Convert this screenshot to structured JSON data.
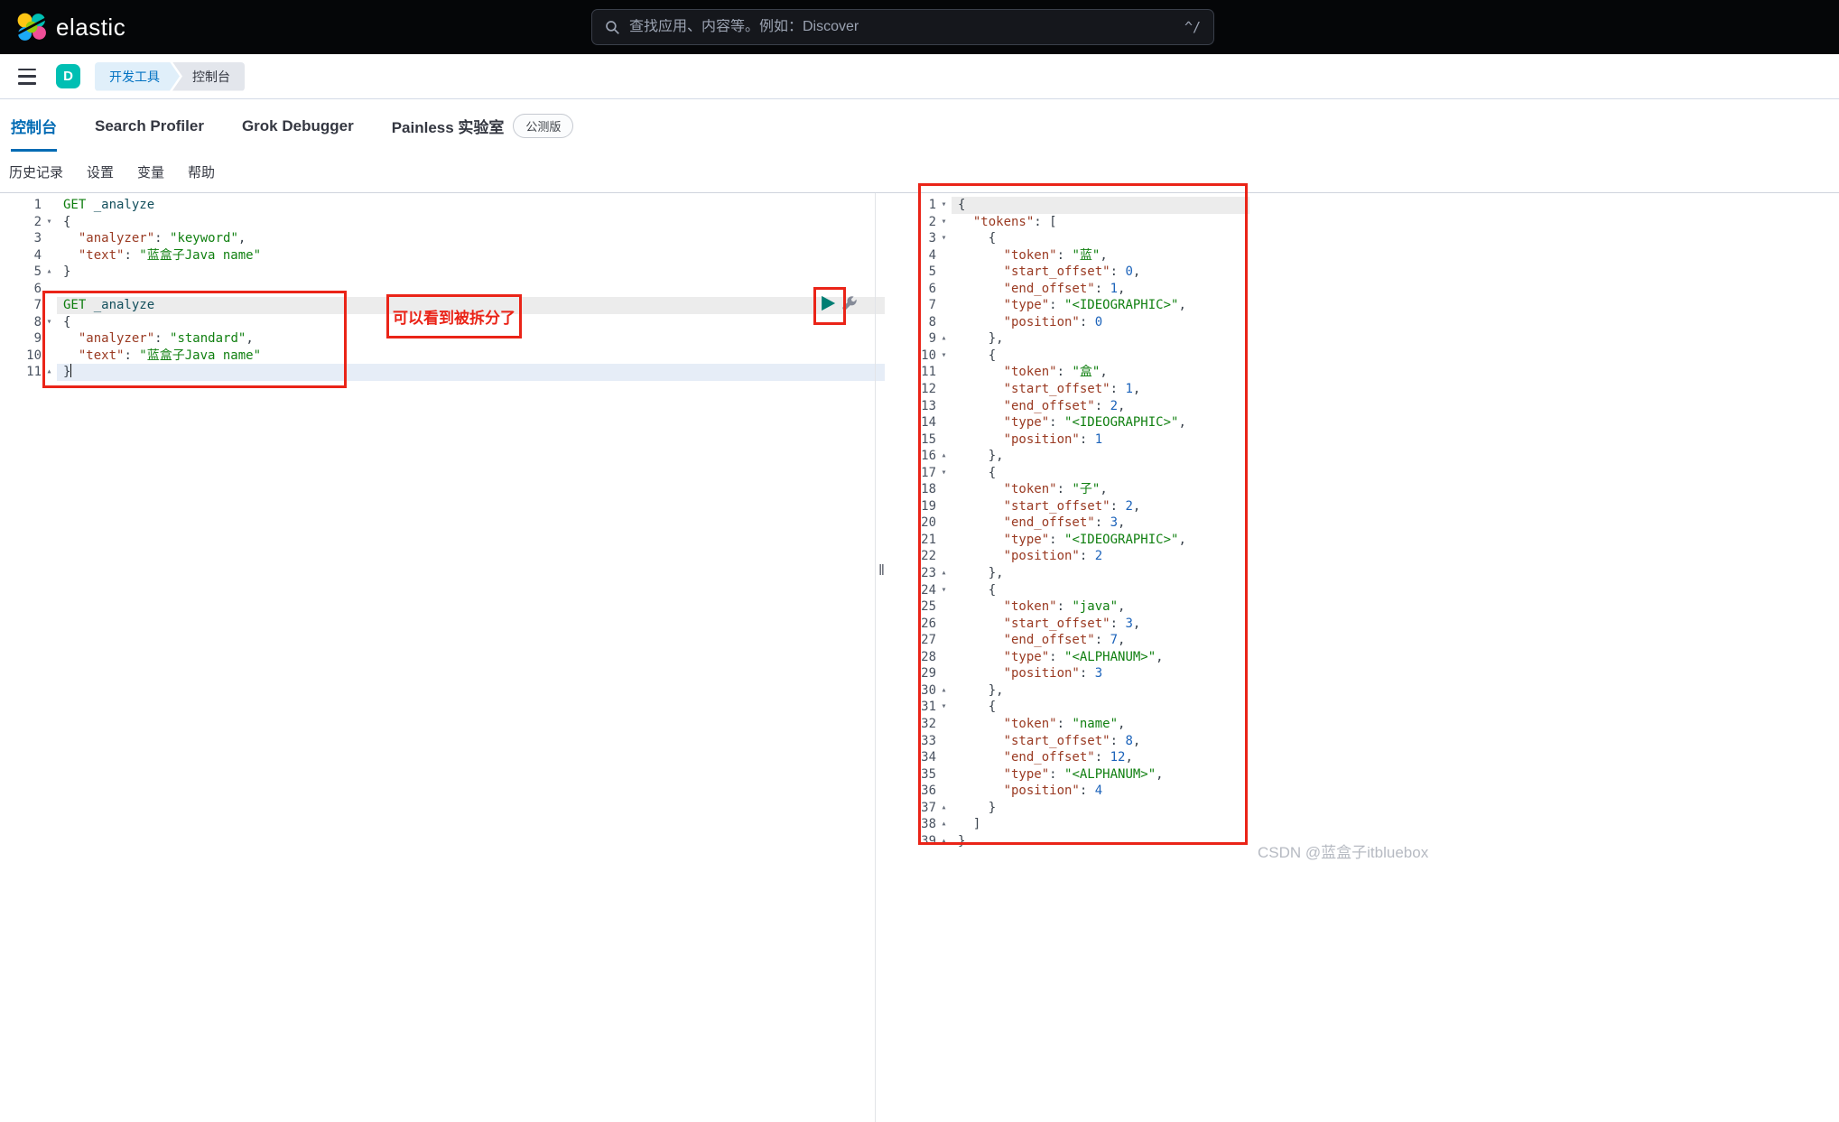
{
  "topbar": {
    "brand": "elastic",
    "search_placeholder": "查找应用、内容等。例如：Discover",
    "shortcut_hint": "^/"
  },
  "navbar": {
    "space_initial": "D",
    "breadcrumbs": [
      "开发工具",
      "控制台"
    ]
  },
  "tabs": {
    "items": [
      {
        "label": "控制台",
        "active": true
      },
      {
        "label": "Search Profiler",
        "active": false
      },
      {
        "label": "Grok Debugger",
        "active": false
      },
      {
        "label": "Painless 实验室",
        "active": false,
        "badge": "公测版"
      }
    ]
  },
  "menubar": {
    "items": [
      "历史记录",
      "设置",
      "变量",
      "帮助"
    ]
  },
  "icons": {
    "search": "magnifier",
    "menu": "hamburger",
    "send": "play-triangle",
    "settings": "wrench",
    "resizer": "‖",
    "fold_open": "▾",
    "fold_collapse": "▴"
  },
  "colors": {
    "accent": "#006bb4",
    "annotation_red": "#ea2418",
    "play_green": "#017d73",
    "space_avatar": "#00bfb3"
  },
  "annotations": {
    "callout_text": "可以看到被拆分了"
  },
  "watermark": "CSDN @蓝盒子itbluebox",
  "editor": {
    "lines": [
      {
        "n": "1",
        "seg": [
          {
            "t": "GET ",
            "c": "m"
          },
          {
            "t": "_analyze",
            "c": "u"
          }
        ]
      },
      {
        "n": "2",
        "f": "d",
        "seg": [
          {
            "t": "{",
            "c": "p"
          }
        ]
      },
      {
        "n": "3",
        "seg": [
          {
            "t": "  "
          },
          {
            "t": "\"analyzer\"",
            "c": "k"
          },
          {
            "t": ": ",
            "c": "p"
          },
          {
            "t": "\"keyword\"",
            "c": "s"
          },
          {
            "t": ",",
            "c": "p"
          }
        ]
      },
      {
        "n": "4",
        "seg": [
          {
            "t": "  "
          },
          {
            "t": "\"text\"",
            "c": "k"
          },
          {
            "t": ": ",
            "c": "p"
          },
          {
            "t": "\"蓝盒子Java name\"",
            "c": "s"
          }
        ]
      },
      {
        "n": "5",
        "f": "u",
        "seg": [
          {
            "t": "}",
            "c": "p"
          }
        ]
      },
      {
        "n": "6",
        "seg": []
      },
      {
        "n": "7",
        "hl": "gray",
        "seg": [
          {
            "t": "GET ",
            "c": "m"
          },
          {
            "t": "_analyze",
            "c": "u"
          }
        ]
      },
      {
        "n": "8",
        "f": "d",
        "seg": [
          {
            "t": "{",
            "c": "p"
          }
        ]
      },
      {
        "n": "9",
        "seg": [
          {
            "t": "  "
          },
          {
            "t": "\"analyzer\"",
            "c": "k"
          },
          {
            "t": ": ",
            "c": "p"
          },
          {
            "t": "\"standard\"",
            "c": "s"
          },
          {
            "t": ",",
            "c": "p"
          }
        ]
      },
      {
        "n": "10",
        "seg": [
          {
            "t": "  "
          },
          {
            "t": "\"text\"",
            "c": "k"
          },
          {
            "t": ": ",
            "c": "p"
          },
          {
            "t": "\"蓝盒子Java name\"",
            "c": "s"
          }
        ]
      },
      {
        "n": "11",
        "f": "u",
        "hl": "blue",
        "cursor": true,
        "seg": [
          {
            "t": "}",
            "c": "p"
          }
        ]
      }
    ]
  },
  "response": {
    "lines": [
      {
        "n": "1",
        "f": "d",
        "hl": "gray",
        "seg": [
          {
            "t": "{",
            "c": "p"
          }
        ]
      },
      {
        "n": "2",
        "f": "d",
        "seg": [
          {
            "t": "  "
          },
          {
            "t": "\"tokens\"",
            "c": "k"
          },
          {
            "t": ": ",
            "c": "p"
          },
          {
            "t": "[",
            "c": "p"
          }
        ]
      },
      {
        "n": "3",
        "f": "d",
        "seg": [
          {
            "t": "    "
          },
          {
            "t": "{",
            "c": "p"
          }
        ]
      },
      {
        "n": "4",
        "seg": [
          {
            "t": "      "
          },
          {
            "t": "\"token\"",
            "c": "k"
          },
          {
            "t": ": ",
            "c": "p"
          },
          {
            "t": "\"蓝\"",
            "c": "s"
          },
          {
            "t": ",",
            "c": "p"
          }
        ]
      },
      {
        "n": "5",
        "seg": [
          {
            "t": "      "
          },
          {
            "t": "\"start_offset\"",
            "c": "k"
          },
          {
            "t": ": ",
            "c": "p"
          },
          {
            "t": "0",
            "c": "n"
          },
          {
            "t": ",",
            "c": "p"
          }
        ]
      },
      {
        "n": "6",
        "seg": [
          {
            "t": "      "
          },
          {
            "t": "\"end_offset\"",
            "c": "k"
          },
          {
            "t": ": ",
            "c": "p"
          },
          {
            "t": "1",
            "c": "n"
          },
          {
            "t": ",",
            "c": "p"
          }
        ]
      },
      {
        "n": "7",
        "seg": [
          {
            "t": "      "
          },
          {
            "t": "\"type\"",
            "c": "k"
          },
          {
            "t": ": ",
            "c": "p"
          },
          {
            "t": "\"<IDEOGRAPHIC>\"",
            "c": "s"
          },
          {
            "t": ",",
            "c": "p"
          }
        ]
      },
      {
        "n": "8",
        "seg": [
          {
            "t": "      "
          },
          {
            "t": "\"position\"",
            "c": "k"
          },
          {
            "t": ": ",
            "c": "p"
          },
          {
            "t": "0",
            "c": "n"
          }
        ]
      },
      {
        "n": "9",
        "f": "u",
        "seg": [
          {
            "t": "    "
          },
          {
            "t": "},",
            "c": "p"
          }
        ]
      },
      {
        "n": "10",
        "f": "d",
        "seg": [
          {
            "t": "    "
          },
          {
            "t": "{",
            "c": "p"
          }
        ]
      },
      {
        "n": "11",
        "seg": [
          {
            "t": "      "
          },
          {
            "t": "\"token\"",
            "c": "k"
          },
          {
            "t": ": ",
            "c": "p"
          },
          {
            "t": "\"盒\"",
            "c": "s"
          },
          {
            "t": ",",
            "c": "p"
          }
        ]
      },
      {
        "n": "12",
        "seg": [
          {
            "t": "      "
          },
          {
            "t": "\"start_offset\"",
            "c": "k"
          },
          {
            "t": ": ",
            "c": "p"
          },
          {
            "t": "1",
            "c": "n"
          },
          {
            "t": ",",
            "c": "p"
          }
        ]
      },
      {
        "n": "13",
        "seg": [
          {
            "t": "      "
          },
          {
            "t": "\"end_offset\"",
            "c": "k"
          },
          {
            "t": ": ",
            "c": "p"
          },
          {
            "t": "2",
            "c": "n"
          },
          {
            "t": ",",
            "c": "p"
          }
        ]
      },
      {
        "n": "14",
        "seg": [
          {
            "t": "      "
          },
          {
            "t": "\"type\"",
            "c": "k"
          },
          {
            "t": ": ",
            "c": "p"
          },
          {
            "t": "\"<IDEOGRAPHIC>\"",
            "c": "s"
          },
          {
            "t": ",",
            "c": "p"
          }
        ]
      },
      {
        "n": "15",
        "seg": [
          {
            "t": "      "
          },
          {
            "t": "\"position\"",
            "c": "k"
          },
          {
            "t": ": ",
            "c": "p"
          },
          {
            "t": "1",
            "c": "n"
          }
        ]
      },
      {
        "n": "16",
        "f": "u",
        "seg": [
          {
            "t": "    "
          },
          {
            "t": "},",
            "c": "p"
          }
        ]
      },
      {
        "n": "17",
        "f": "d",
        "seg": [
          {
            "t": "    "
          },
          {
            "t": "{",
            "c": "p"
          }
        ]
      },
      {
        "n": "18",
        "seg": [
          {
            "t": "      "
          },
          {
            "t": "\"token\"",
            "c": "k"
          },
          {
            "t": ": ",
            "c": "p"
          },
          {
            "t": "\"子\"",
            "c": "s"
          },
          {
            "t": ",",
            "c": "p"
          }
        ]
      },
      {
        "n": "19",
        "seg": [
          {
            "t": "      "
          },
          {
            "t": "\"start_offset\"",
            "c": "k"
          },
          {
            "t": ": ",
            "c": "p"
          },
          {
            "t": "2",
            "c": "n"
          },
          {
            "t": ",",
            "c": "p"
          }
        ]
      },
      {
        "n": "20",
        "seg": [
          {
            "t": "      "
          },
          {
            "t": "\"end_offset\"",
            "c": "k"
          },
          {
            "t": ": ",
            "c": "p"
          },
          {
            "t": "3",
            "c": "n"
          },
          {
            "t": ",",
            "c": "p"
          }
        ]
      },
      {
        "n": "21",
        "seg": [
          {
            "t": "      "
          },
          {
            "t": "\"type\"",
            "c": "k"
          },
          {
            "t": ": ",
            "c": "p"
          },
          {
            "t": "\"<IDEOGRAPHIC>\"",
            "c": "s"
          },
          {
            "t": ",",
            "c": "p"
          }
        ]
      },
      {
        "n": "22",
        "seg": [
          {
            "t": "      "
          },
          {
            "t": "\"position\"",
            "c": "k"
          },
          {
            "t": ": ",
            "c": "p"
          },
          {
            "t": "2",
            "c": "n"
          }
        ]
      },
      {
        "n": "23",
        "f": "u",
        "seg": [
          {
            "t": "    "
          },
          {
            "t": "},",
            "c": "p"
          }
        ]
      },
      {
        "n": "24",
        "f": "d",
        "seg": [
          {
            "t": "    "
          },
          {
            "t": "{",
            "c": "p"
          }
        ]
      },
      {
        "n": "25",
        "seg": [
          {
            "t": "      "
          },
          {
            "t": "\"token\"",
            "c": "k"
          },
          {
            "t": ": ",
            "c": "p"
          },
          {
            "t": "\"java\"",
            "c": "s"
          },
          {
            "t": ",",
            "c": "p"
          }
        ]
      },
      {
        "n": "26",
        "seg": [
          {
            "t": "      "
          },
          {
            "t": "\"start_offset\"",
            "c": "k"
          },
          {
            "t": ": ",
            "c": "p"
          },
          {
            "t": "3",
            "c": "n"
          },
          {
            "t": ",",
            "c": "p"
          }
        ]
      },
      {
        "n": "27",
        "seg": [
          {
            "t": "      "
          },
          {
            "t": "\"end_offset\"",
            "c": "k"
          },
          {
            "t": ": ",
            "c": "p"
          },
          {
            "t": "7",
            "c": "n"
          },
          {
            "t": ",",
            "c": "p"
          }
        ]
      },
      {
        "n": "28",
        "seg": [
          {
            "t": "      "
          },
          {
            "t": "\"type\"",
            "c": "k"
          },
          {
            "t": ": ",
            "c": "p"
          },
          {
            "t": "\"<ALPHANUM>\"",
            "c": "s"
          },
          {
            "t": ",",
            "c": "p"
          }
        ]
      },
      {
        "n": "29",
        "seg": [
          {
            "t": "      "
          },
          {
            "t": "\"position\"",
            "c": "k"
          },
          {
            "t": ": ",
            "c": "p"
          },
          {
            "t": "3",
            "c": "n"
          }
        ]
      },
      {
        "n": "30",
        "f": "u",
        "seg": [
          {
            "t": "    "
          },
          {
            "t": "},",
            "c": "p"
          }
        ]
      },
      {
        "n": "31",
        "f": "d",
        "seg": [
          {
            "t": "    "
          },
          {
            "t": "{",
            "c": "p"
          }
        ]
      },
      {
        "n": "32",
        "seg": [
          {
            "t": "      "
          },
          {
            "t": "\"token\"",
            "c": "k"
          },
          {
            "t": ": ",
            "c": "p"
          },
          {
            "t": "\"name\"",
            "c": "s"
          },
          {
            "t": ",",
            "c": "p"
          }
        ]
      },
      {
        "n": "33",
        "seg": [
          {
            "t": "      "
          },
          {
            "t": "\"start_offset\"",
            "c": "k"
          },
          {
            "t": ": ",
            "c": "p"
          },
          {
            "t": "8",
            "c": "n"
          },
          {
            "t": ",",
            "c": "p"
          }
        ]
      },
      {
        "n": "34",
        "seg": [
          {
            "t": "      "
          },
          {
            "t": "\"end_offset\"",
            "c": "k"
          },
          {
            "t": ": ",
            "c": "p"
          },
          {
            "t": "12",
            "c": "n"
          },
          {
            "t": ",",
            "c": "p"
          }
        ]
      },
      {
        "n": "35",
        "seg": [
          {
            "t": "      "
          },
          {
            "t": "\"type\"",
            "c": "k"
          },
          {
            "t": ": ",
            "c": "p"
          },
          {
            "t": "\"<ALPHANUM>\"",
            "c": "s"
          },
          {
            "t": ",",
            "c": "p"
          }
        ]
      },
      {
        "n": "36",
        "seg": [
          {
            "t": "      "
          },
          {
            "t": "\"position\"",
            "c": "k"
          },
          {
            "t": ": ",
            "c": "p"
          },
          {
            "t": "4",
            "c": "n"
          }
        ]
      },
      {
        "n": "37",
        "f": "u",
        "seg": [
          {
            "t": "    "
          },
          {
            "t": "}",
            "c": "p"
          }
        ]
      },
      {
        "n": "38",
        "f": "u",
        "seg": [
          {
            "t": "  "
          },
          {
            "t": "]",
            "c": "p"
          }
        ]
      },
      {
        "n": "39",
        "f": "u",
        "seg": [
          {
            "t": "}",
            "c": "p"
          }
        ]
      }
    ]
  }
}
